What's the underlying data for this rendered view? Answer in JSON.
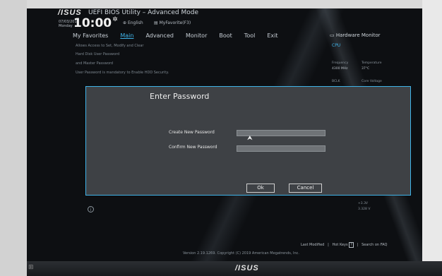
{
  "header": {
    "logo": "/ISUS",
    "title": "UEFI BIOS Utility – Advanced Mode",
    "date": "07/03/2019\nMonday",
    "time": "10:00",
    "language": "English",
    "favorites": "MyFavorite(F3)"
  },
  "tabs": [
    {
      "label": "My Favorites"
    },
    {
      "label": "Main"
    },
    {
      "label": "Advanced"
    },
    {
      "label": "Monitor"
    },
    {
      "label": "Boot"
    },
    {
      "label": "Tool"
    },
    {
      "label": "Exit"
    }
  ],
  "menu_lines": [
    "Allows Access to Set, Modify and Clear",
    "Hard Disk  User  Password",
    "and  Master  Password",
    "User Password is mandatory to Enable HDD Security."
  ],
  "hardware_monitor": {
    "title": "Hardware Monitor",
    "cpu_label": "CPU",
    "frequency_label": "Frequency",
    "frequency_value": "4300 MHz",
    "temperature_label": "Temperature",
    "temperature_value": "37°C",
    "bclk_label": "BCLK",
    "core_voltage_label": "Core Voltage",
    "volt_a": "+3.3V",
    "volt_b": "3.328 V"
  },
  "dialog": {
    "title": "Enter Password",
    "create_label": "Create New Password",
    "confirm_label": "Confirm New Password",
    "create_value": "",
    "confirm_value": "",
    "ok_label": "Ok",
    "cancel_label": "Cancel"
  },
  "footer": {
    "last_modified": "Last Modified",
    "hot_keys": "Hot Keys",
    "hot_keys_key": "?",
    "search_faq": "Search on FAQ",
    "version": "Version 2.19.1269. Copyright (C) 2019 American Megatrends, Inc."
  },
  "stand_logo": "/ISUS",
  "colors": {
    "accent": "#3fb3e8",
    "background": "#0d0f12",
    "dialog": "#3e4145"
  }
}
